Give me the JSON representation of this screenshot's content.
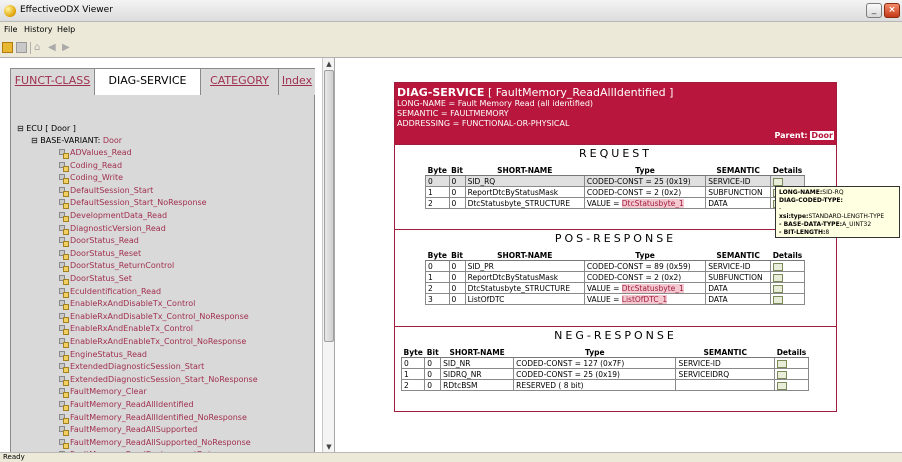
{
  "window": {
    "title": "EffectiveODX Viewer",
    "minimize_glyph": "_",
    "maximize_glyph": "□",
    "close_glyph": "×"
  },
  "menu": [
    "File",
    "History",
    "Help"
  ],
  "toolbar": {
    "icons": [
      "open-icon",
      "save-icon",
      "home-icon",
      "back-icon",
      "forward-icon"
    ],
    "home_glyph": "⌂",
    "back_glyph": "◀",
    "forward_glyph": "▶"
  },
  "tabs": [
    {
      "label": "FUNCT-CLASS",
      "active": false
    },
    {
      "label": "DIAG-SERVICE",
      "active": true
    },
    {
      "label": "CATEGORY",
      "active": false
    },
    {
      "label": "Index",
      "active": false
    }
  ],
  "tree": {
    "root_toggle": "⊟",
    "root_label": "ECU [ Door ]",
    "bv_toggle": "⊟",
    "bv_prefix": "BASE-VARIANT:",
    "bv_name": "Door",
    "services": [
      "ADValues_Read",
      "Coding_Read",
      "Coding_Write",
      "DefaultSession_Start",
      "DefaultSession_Start_NoResponse",
      "DevelopmentData_Read",
      "DiagnosticVersion_Read",
      "DoorStatus_Read",
      "DoorStatus_Reset",
      "DoorStatus_ReturnControl",
      "DoorStatus_Set",
      "EcuIdentification_Read",
      "EnableRxAndDisableTx_Control",
      "EnableRxAndDisableTx_Control_NoResponse",
      "EnableRxAndEnableTx_Control",
      "EnableRxAndEnableTx_Control_NoResponse",
      "EngineStatus_Read",
      "ExtendedDiagnosticSession_Start",
      "ExtendedDiagnosticSession_Start_NoResponse",
      "FaultMemory_Clear",
      "FaultMemory_ReadAllIdentified",
      "FaultMemory_ReadAllIdentified_NoResponse",
      "FaultMemory_ReadAllSupported",
      "FaultMemory_ReadAllSupported_NoResponse",
      "FaultMemory_ReadEnvironmentData"
    ],
    "scroll_up_glyph": "▲",
    "scroll_down_glyph": "▼"
  },
  "service": {
    "kind": "DIAG-SERVICE",
    "title_open": "[",
    "name": "FaultMemory_ReadAllIdentified",
    "title_close": "]",
    "long_name": "LONG-NAME = Fault Memory Read (all identified)",
    "semantic": "SEMANTIC = FAULTMEMORY",
    "addressing": "ADDRESSING = FUNCTIONAL-OR-PHYSICAL",
    "parent_label": "Parent:",
    "parent_value": "Door"
  },
  "columns": [
    "Byte",
    "Bit",
    "SHORT-NAME",
    "Type",
    "SEMANTIC",
    "Details"
  ],
  "request": {
    "title": "REQUEST",
    "rows": [
      {
        "byte": "0",
        "bit": "0",
        "name": "SID_RQ",
        "type_prefix": "CODED-CONST = 25 (0x19)",
        "type_link": "",
        "semantic": "SERVICE-ID"
      },
      {
        "byte": "1",
        "bit": "0",
        "name": "ReportDtcByStatusMask",
        "type_prefix": "CODED-CONST = 2 (0x2)",
        "type_link": "",
        "semantic": "SUBFUNCTION"
      },
      {
        "byte": "2",
        "bit": "0",
        "name": "DtcStatusbyte_STRUCTURE",
        "type_prefix": "VALUE = ",
        "type_link": "DtcStatusbyte_1",
        "semantic": "DATA"
      }
    ]
  },
  "pos_response": {
    "title": "POS-RESPONSE",
    "rows": [
      {
        "byte": "0",
        "bit": "0",
        "name": "SID_PR",
        "type_prefix": "CODED-CONST = 89 (0x59)",
        "type_link": "",
        "semantic": "SERVICE-ID"
      },
      {
        "byte": "1",
        "bit": "0",
        "name": "ReportDtcByStatusMask",
        "type_prefix": "CODED-CONST = 2 (0x2)",
        "type_link": "",
        "semantic": "SUBFUNCTION"
      },
      {
        "byte": "2",
        "bit": "0",
        "name": "DtcStatusbyte_STRUCTURE",
        "type_prefix": "VALUE = ",
        "type_link": "DtcStatusbyte_1",
        "semantic": "DATA"
      },
      {
        "byte": "3",
        "bit": "0",
        "name": "ListOfDTC",
        "type_prefix": "VALUE = ",
        "type_link": "ListOfDTC_1",
        "semantic": "DATA"
      }
    ]
  },
  "neg_response": {
    "title": "NEG-RESPONSE",
    "rows": [
      {
        "byte": "0",
        "bit": "0",
        "name": "SID_NR",
        "type_prefix": "CODED-CONST = 127 (0x7F)",
        "type_link": "",
        "semantic": "SERVICE-ID"
      },
      {
        "byte": "1",
        "bit": "0",
        "name": "SIDRQ_NR",
        "type_prefix": "CODED-CONST = 25 (0x19)",
        "type_link": "",
        "semantic": "SERVICEIDRQ"
      },
      {
        "byte": "2",
        "bit": "0",
        "name": "RDtcBSM",
        "type_prefix": "RESERVED ( 8 bit)",
        "type_link": "",
        "semantic": ""
      }
    ]
  },
  "tooltip": {
    "l1k": "LONG-NAME:",
    "l1v": "SID-RQ",
    "l2k": "DIAG-CODED-TYPE:",
    "l2v": "",
    "l3": "-",
    "l4k": "xsi:type:",
    "l4v": "STANDARD-LENGTH-TYPE",
    "l5k": "- BASE-DATA-TYPE:",
    "l5v": "A_UINT32",
    "l6k": "- BIT-LENGTH:",
    "l6v": "8"
  },
  "status": "Ready"
}
